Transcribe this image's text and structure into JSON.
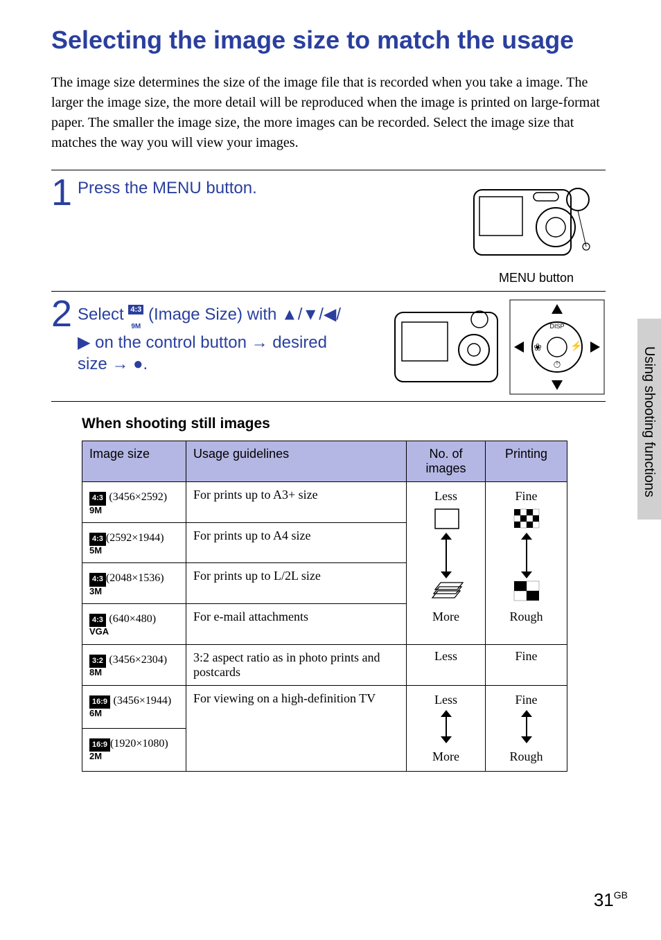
{
  "title": "Selecting the image size to match the usage",
  "intro": "The image size determines the size of the image file that is recorded when you take a image.\nThe larger the image size, the more detail will be reproduced when the image is printed on large-format paper. The smaller the image size, the more images can be recorded. Select the image size that matches the way you will view your images.",
  "side_tab": "Using shooting functions",
  "step1": {
    "num": "1",
    "text": "Press the MENU button.",
    "caption": "MENU button"
  },
  "step2": {
    "num": "2",
    "prefix": "Select ",
    "badge_top": "4:3",
    "badge_bottom": "9M",
    "mid": " (Image Size) with ▲/▼/◀/▶ on the control button → desired size → ●."
  },
  "subheading": "When shooting still images",
  "table": {
    "headers": [
      "Image size",
      "Usage guidelines",
      "No. of images",
      "Printing"
    ],
    "rows": [
      {
        "ratio": "4:3",
        "suffix": "9M",
        "dims": "(3456×2592)",
        "usage": "For prints up to A3+ size"
      },
      {
        "ratio": "4:3",
        "suffix": "5M",
        "dims": "(2592×1944)",
        "usage": "For prints up to A4 size"
      },
      {
        "ratio": "4:3",
        "suffix": "3M",
        "dims": "(2048×1536)",
        "usage": "For prints up to L/2L size"
      },
      {
        "ratio": "4:3",
        "suffix": "VGA",
        "dims": "(640×480)",
        "usage": "For e-mail attachments"
      },
      {
        "ratio": "3:2",
        "suffix": "8M",
        "dims": "(3456×2304)",
        "usage": "3:2 aspect ratio as in photo prints and postcards"
      },
      {
        "ratio": "16:9",
        "suffix": "6M",
        "dims": "(3456×1944)",
        "usage": "For viewing on a high-definition TV"
      },
      {
        "ratio": "16:9",
        "suffix": "2M",
        "dims": "(1920×1080)",
        "usage": ""
      }
    ],
    "scale_a": {
      "top": "Less",
      "bottom": "More"
    },
    "scale_b": {
      "top": "Fine",
      "bottom": "Rough"
    },
    "scale_c": {
      "top": "Less",
      "bottom": "More"
    },
    "scale_d": {
      "top": "Fine",
      "bottom": "Rough"
    }
  },
  "page": {
    "num": "31",
    "region": "GB"
  }
}
